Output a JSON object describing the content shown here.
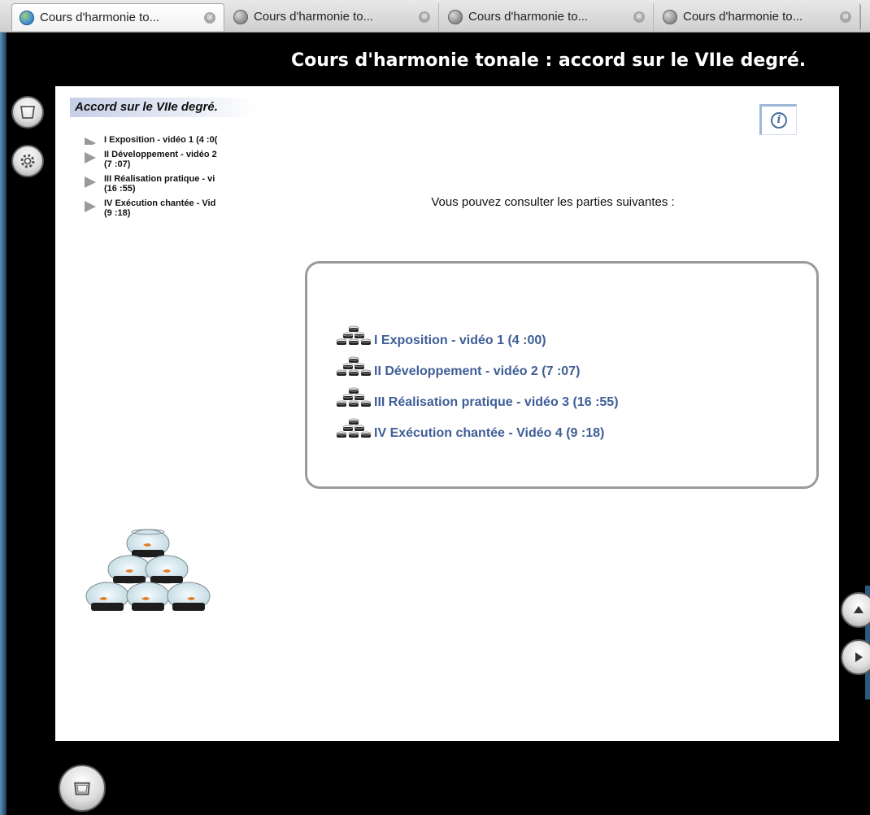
{
  "browser": {
    "tabs": [
      {
        "title": "Cours d'harmonie to...",
        "active": true
      },
      {
        "title": "Cours d'harmonie to...",
        "active": false
      },
      {
        "title": "Cours d'harmonie to...",
        "active": false
      },
      {
        "title": "Cours d'harmonie to...",
        "active": false
      }
    ],
    "close_glyph": "⊗"
  },
  "page": {
    "title": "Cours d'harmonie tonale : accord sur le VIIe degré."
  },
  "sidebar": {
    "title": "Accord sur le VIIe degré.",
    "items": [
      {
        "line1": "I Exposition - vidéo 1 (4 :0(",
        "line2": ""
      },
      {
        "line1": "II Développement - vidéo 2",
        "line2": "(7 :07)"
      },
      {
        "line1": "III Réalisation pratique - vi",
        "line2": "(16 :55)"
      },
      {
        "line1": "IV Exécution chantée - Vid",
        "line2": "(9 :18)"
      }
    ]
  },
  "main": {
    "intro": "Vous pouvez consulter les parties suivantes :",
    "parts": [
      {
        "label": "I Exposition - vidéo 1 (4 :00)"
      },
      {
        "label": "II Développement - vidéo 2 (7 :07)"
      },
      {
        "label": "III Réalisation pratique - vidéo 3 (16 :55)"
      },
      {
        "label": "IV Exécution chantée - Vidéo 4 (9 :18)"
      }
    ]
  },
  "icons": {
    "tab": "globe-icon",
    "info": "info-icon",
    "sidebar_top": "screen-icon",
    "sidebar_gear": "gear-icon",
    "bottom": "screen-icon",
    "nav_up": "triangle-up-icon",
    "nav_next": "triangle-right-icon",
    "illustration": "fishbowl-pyramid-icon"
  },
  "colors": {
    "link": "#3f5e97",
    "title_bar": "#000000",
    "sidebar_highlight": "#c6cfe8"
  }
}
